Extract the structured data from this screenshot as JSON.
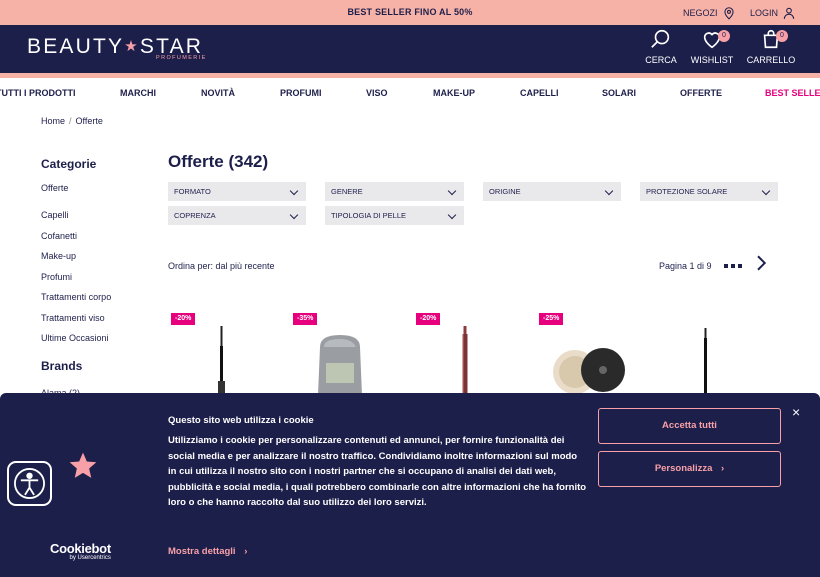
{
  "promo": {
    "text": "BEST SELLER FINO AL 50%",
    "stores_label": "NEGOZI",
    "login_label": "LOGIN"
  },
  "header": {
    "logo_left": "BEAUTY",
    "logo_right": "STAR",
    "logo_sub": "PROFUMERIE",
    "search_label": "CERCA",
    "wishlist_label": "WISHLIST",
    "wishlist_count": "0",
    "cart_label": "CARRELLO",
    "cart_count": "0"
  },
  "nav": [
    "TUTTI I PRODOTTI",
    "MARCHI",
    "NOVITÀ",
    "PROFUMI",
    "VISO",
    "MAKE-UP",
    "CAPELLI",
    "SOLARI",
    "OFFERTE",
    "BEST SELLER"
  ],
  "breadcrumb": {
    "home": "Home",
    "separator": "/",
    "current": "Offerte"
  },
  "sidebar": {
    "categories_title": "Categorie",
    "active_category": "Offerte",
    "categories": [
      "Capelli",
      "Cofanetti",
      "Make-up",
      "Profumi",
      "Trattamenti corpo",
      "Trattamenti viso",
      "Ultime Occasioni"
    ],
    "brands_title": "Brands",
    "brand_partial": "Alama (2)"
  },
  "main": {
    "title": "Offerte (342)",
    "filters": [
      "FORMATO",
      "GENERE",
      "ORIGINE",
      "PROTEZIONE SOLARE",
      "COPRENZA",
      "TIPOLOGIA DI PELLE"
    ],
    "sort_label": "Ordina per: dal più recente",
    "pagination": "Pagina 1 di 9"
  },
  "products": [
    {
      "discount": "-20%"
    },
    {
      "discount": "-35%"
    },
    {
      "discount": "-20%"
    },
    {
      "discount": "-25%"
    },
    {
      "discount": ""
    }
  ],
  "cookie": {
    "title": "Questo sito web utilizza i cookie",
    "text": "Utilizziamo i cookie per personalizzare contenuti ed annunci, per fornire funzionalità dei social media e per analizzare il nostro traffico. Condividiamo inoltre informazioni sul modo in cui utilizza il nostro sito con i nostri partner che si occupano di analisi dei dati web, pubblicità e social media, i quali potrebbero combinarle con altre informazioni che ha fornito loro o che hanno raccolto dal suo utilizzo dei loro servizi.",
    "more_label": "Mostra dettagli",
    "accept_label": "Accetta tutti",
    "customize_label": "Personalizza",
    "close": "×",
    "brand": "Cookiebot",
    "brand_sub": "by Usercentrics"
  },
  "colors": {
    "navy": "#1d1f4b",
    "pink": "#f7b2a7",
    "magenta": "#e6007e",
    "filter_bg": "#e9e9ec"
  },
  "icons": [
    "location-pin-icon",
    "user-icon",
    "search-icon",
    "heart-icon",
    "shopping-bag-icon",
    "chevron-right-icon",
    "close-icon",
    "accessibility-icon",
    "star-icon"
  ]
}
